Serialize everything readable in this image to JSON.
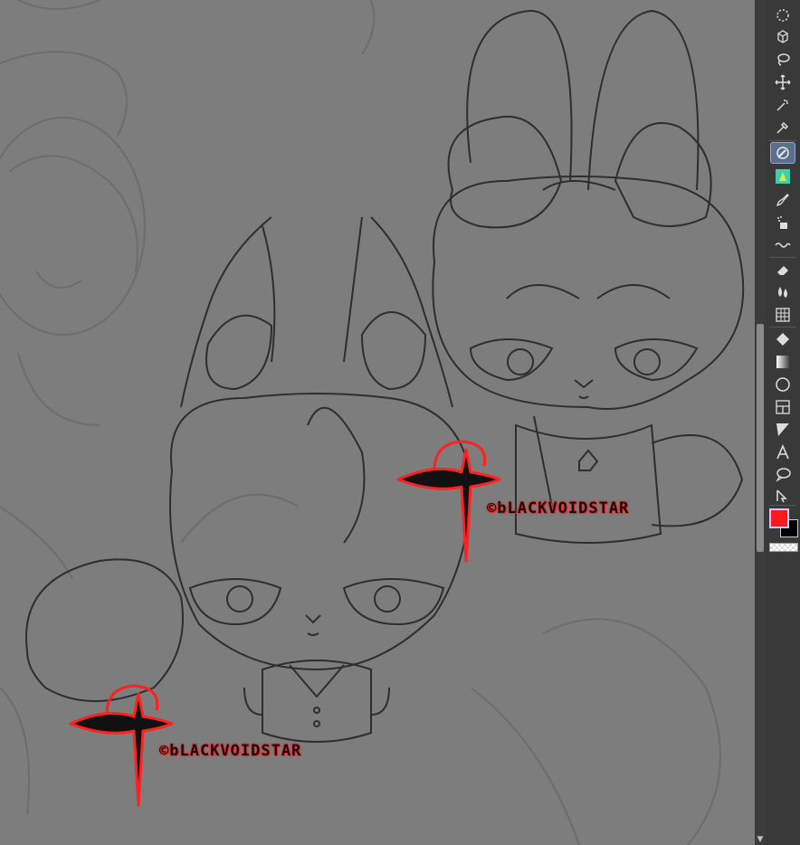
{
  "canvas": {
    "background": "#7d7d7d",
    "line_color": "#2e2e2e",
    "sketch_color": "#6c6c6c"
  },
  "watermarks": [
    {
      "text": "©bLACKVOIDSTAR",
      "color": "#ff2020"
    },
    {
      "text": "©bLACKVOIDSTAR",
      "color": "#ff2020"
    }
  ],
  "toolbar": {
    "tools": [
      {
        "icon": "dotted-circle-icon"
      },
      {
        "icon": "layer-move-icon"
      },
      {
        "icon": "lasso-icon"
      },
      {
        "icon": "move-icon"
      },
      {
        "icon": "magic-wand-icon"
      },
      {
        "icon": "eyedropper-icon"
      },
      {
        "icon": "pen-icon",
        "active": true
      },
      {
        "icon": "pencil-icon"
      },
      {
        "icon": "brush-icon"
      },
      {
        "icon": "airbrush-icon"
      },
      {
        "icon": "decoration-icon"
      },
      {
        "icon": "eraser-icon"
      },
      {
        "icon": "blend-icon"
      },
      {
        "icon": "grid-icon"
      },
      {
        "icon": "fill-icon"
      },
      {
        "icon": "gradient-icon"
      },
      {
        "icon": "ellipse-icon"
      },
      {
        "icon": "frame-icon"
      },
      {
        "icon": "ruler-icon"
      },
      {
        "icon": "text-icon"
      },
      {
        "icon": "balloon-icon"
      },
      {
        "icon": "correct-line-icon"
      }
    ],
    "main_color": "#ff1a1a",
    "sub_color": "#000000"
  }
}
